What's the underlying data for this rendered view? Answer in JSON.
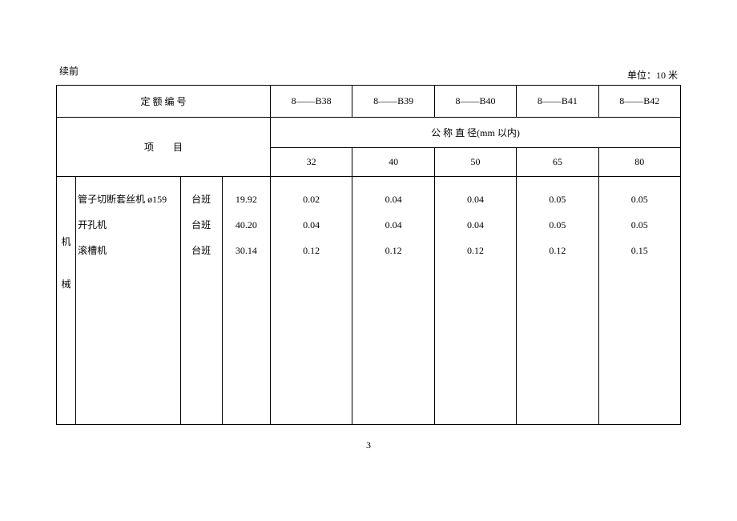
{
  "labels": {
    "continued": "续前",
    "unit": "单位：10 米",
    "quota_no": "定 额 编 号",
    "project": "项　　目",
    "nominal_dia": "公 称 直 径(mm 以内)",
    "side_char1": "机",
    "side_char2": "械",
    "page_number": "3"
  },
  "columns": {
    "codes": [
      "8——B38",
      "8——B39",
      "8——B40",
      "8——B41",
      "8——B42"
    ],
    "diameters": [
      "32",
      "40",
      "50",
      "65",
      "80"
    ]
  },
  "rows": [
    {
      "item": "管子切断套丝机 ø159",
      "unit": "台班",
      "price": "19.92",
      "vals": [
        "0.02",
        "0.04",
        "0.04",
        "0.05",
        "0.05"
      ]
    },
    {
      "item": "开孔机",
      "unit": "台班",
      "price": "40.20",
      "vals": [
        "0.04",
        "0.04",
        "0.04",
        "0.05",
        "0.05"
      ]
    },
    {
      "item": "滚槽机",
      "unit": "台班",
      "price": "30.14",
      "vals": [
        "0.12",
        "0.12",
        "0.12",
        "0.12",
        "0.15"
      ]
    }
  ]
}
